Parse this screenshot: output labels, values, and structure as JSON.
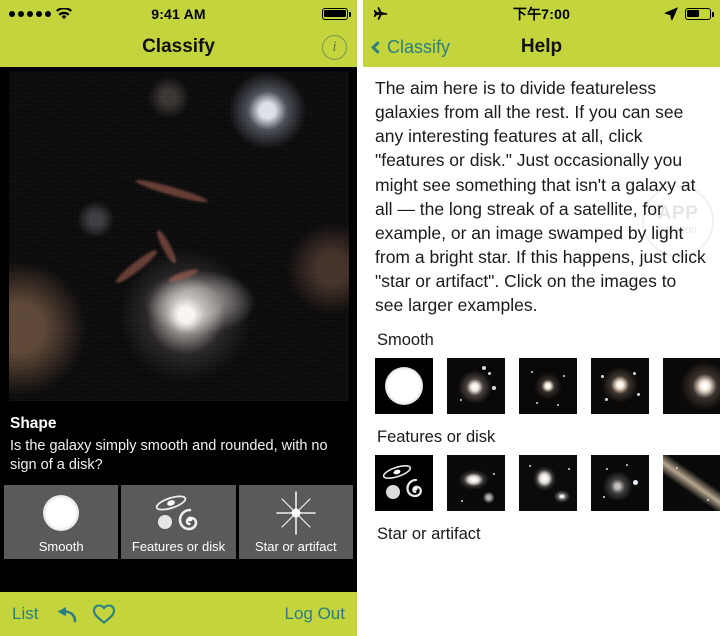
{
  "left_screen": {
    "status_bar": {
      "signal_dots": 5,
      "wifi_icon": "wifi-icon",
      "time": "9:41 AM",
      "battery_icon": "battery-full-icon",
      "battery_level": 100
    },
    "nav": {
      "title": "Classify",
      "info_icon": "info-circle-icon",
      "info_glyph": "i"
    },
    "subject_image": {
      "name": "galaxy-subject-image",
      "alt": "Deep space image of a smooth elliptical galaxy with faint red filaments and a bright star"
    },
    "question": {
      "title": "Shape",
      "text": "Is the galaxy simply smooth and rounded, with no sign of a disk?"
    },
    "answers": [
      {
        "label": "Smooth",
        "icon": "smooth-galaxy-icon"
      },
      {
        "label": "Features or disk",
        "icon": "features-disk-galaxy-icon"
      },
      {
        "label": "Star or artifact",
        "icon": "star-artifact-icon"
      }
    ],
    "toolbar": {
      "list_label": "List",
      "undo_icon": "undo-arrow-icon",
      "favorite_icon": "heart-icon",
      "logout_label": "Log Out"
    }
  },
  "right_screen": {
    "status_bar": {
      "airplane_icon": "airplane-mode-icon",
      "time": "下午7:00",
      "location_icon": "location-arrow-icon",
      "battery_icon": "battery-half-icon",
      "battery_level": 55
    },
    "nav": {
      "back_label": "Classify",
      "back_icon": "chevron-left-icon",
      "title": "Help"
    },
    "help_text": "The aim here is to divide featureless galaxies from all the rest. If you can see any interesting features at all, click \"features or disk.\" Just occasionally you might see something that isn't a galaxy at all — the long streak of a satellite, for example, or an image swamped by light from a bright star. If this happens, just click \"star or artifact\". Click on the images to see larger examples.",
    "sections": [
      {
        "title": "Smooth",
        "thumbnails": [
          {
            "name": "smooth-example-icon",
            "type": "icon"
          },
          {
            "name": "smooth-example-1",
            "type": "photo"
          },
          {
            "name": "smooth-example-2",
            "type": "photo"
          },
          {
            "name": "smooth-example-3",
            "type": "photo"
          },
          {
            "name": "smooth-example-4",
            "type": "photo"
          }
        ]
      },
      {
        "title": "Features or disk",
        "thumbnails": [
          {
            "name": "features-example-icon",
            "type": "icon"
          },
          {
            "name": "features-example-1",
            "type": "photo"
          },
          {
            "name": "features-example-2",
            "type": "photo"
          },
          {
            "name": "features-example-3",
            "type": "photo"
          },
          {
            "name": "features-example-4",
            "type": "photo"
          }
        ]
      },
      {
        "title": "Star or artifact",
        "thumbnails": []
      }
    ],
    "watermark": {
      "line1": "APP",
      "line2": "solution"
    }
  },
  "colors": {
    "brand_green": "#c3d43c",
    "accent_teal": "#2c7f80",
    "panel_black": "#000000",
    "answer_tile": "#5a5a5a"
  }
}
